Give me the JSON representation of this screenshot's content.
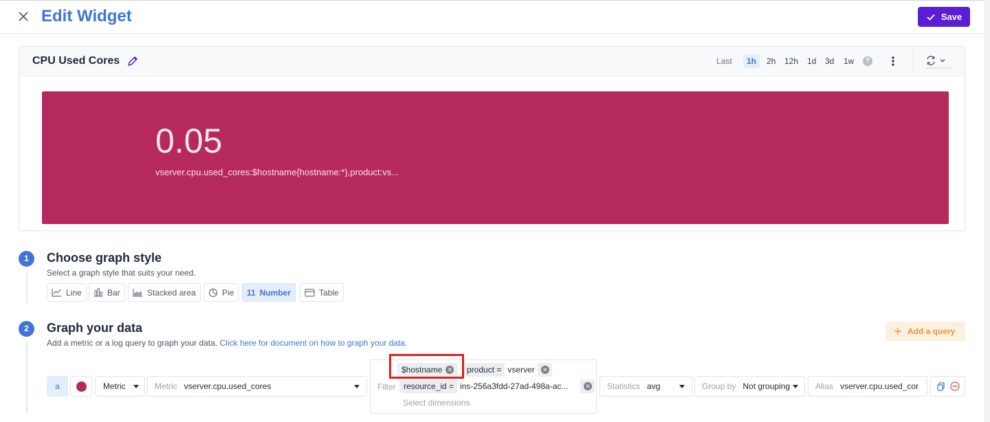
{
  "header": {
    "title": "Edit Widget",
    "save_label": "Save"
  },
  "widget": {
    "title": "CPU Used Cores",
    "time": {
      "last_label": "Last",
      "options": [
        "1h",
        "2h",
        "12h",
        "1d",
        "3d",
        "1w"
      ],
      "selected": "1h",
      "help": "?"
    },
    "number": {
      "value": "0.05",
      "query": "vserver.cpu.used_cores:$hostname{hostname:*},product:vs...",
      "color": "#b6295e"
    }
  },
  "step1": {
    "number": "1",
    "title": "Choose graph style",
    "desc": "Select a graph style that suits your need.",
    "styles": [
      {
        "label": "Line",
        "icon": "line-chart-icon"
      },
      {
        "label": "Bar",
        "icon": "bar-chart-icon"
      },
      {
        "label": "Stacked area",
        "icon": "area-chart-icon"
      },
      {
        "label": "Pie",
        "icon": "pie-chart-icon"
      },
      {
        "label": "Number",
        "icon": "number-icon",
        "icon_text": "11"
      },
      {
        "label": "Table",
        "icon": "table-icon"
      }
    ],
    "selected": "Number"
  },
  "step2": {
    "number": "2",
    "title": "Graph your data",
    "desc": "Add a metric or a log query to graph your data.",
    "link": "Click here for document on how to graph your data.",
    "add_query": "Add a query"
  },
  "query": {
    "letter": "a",
    "color": "#b6295e",
    "type": "Metric",
    "metric_label": "Metric",
    "metric": "vserver.cpu.used_cores",
    "filter_label": "Filter",
    "filters": [
      {
        "key": "$hostname",
        "value": ""
      },
      {
        "key": "product =",
        "value": "vserver"
      },
      {
        "key": "resource_id =",
        "value": "ins-256a3fdd-27ad-498a-ac..."
      }
    ],
    "filter_placeholder": "Select dimensions",
    "statistics_label": "Statistics",
    "statistics": "avg",
    "group_label": "Group by",
    "group": "Not grouping",
    "alias_label": "Alias",
    "alias": "vserver.cpu.used_cor"
  },
  "accent": "#3f76d4",
  "save_color": "#5b1ed6"
}
